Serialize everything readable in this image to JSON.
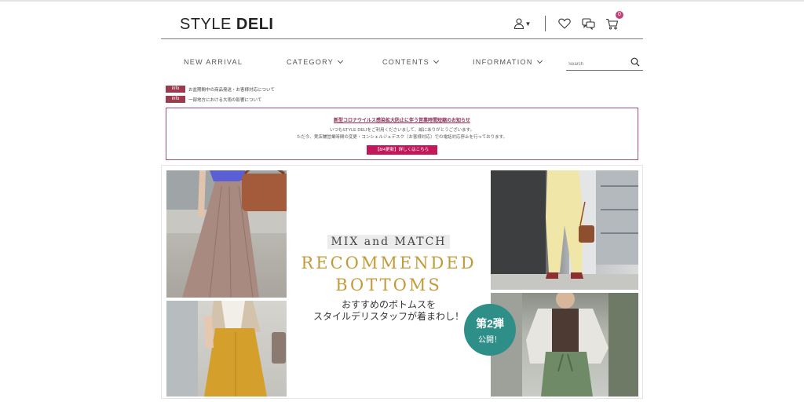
{
  "header": {
    "logo_light": "STYLE",
    "logo_bold": "DELI",
    "cart_count": "0"
  },
  "nav": {
    "items": [
      {
        "label": "NEW ARRIVAL"
      },
      {
        "label": "CATEGORY"
      },
      {
        "label": "CONTENTS"
      },
      {
        "label": "INFORMATION"
      }
    ],
    "search_placeholder": "Search"
  },
  "info": [
    {
      "tag": "info",
      "text": "お盆期間中の商品発送・お客様対応について"
    },
    {
      "tag": "info",
      "text": "一部地方における大雨の影響について"
    }
  ],
  "notice": {
    "title": "新型コロナウイルス感染拡大防止に伴う営業時間短縮のお知らせ",
    "line1": "いつもSTYLE DELIをご利用くださいまして、誠にありがとうございます。",
    "line2": "ただ今、実店舗営業時間の変更・コンシェルジュデスク（お客様対応）での電話対応停止を行っております。",
    "button": "【8/4更新】詳しくはこちら"
  },
  "banner": {
    "mix": "MIX and MATCH",
    "title1": "RECOMMENDED",
    "title2": "BOTTOMS",
    "jp1": "おすすめのボトムスを",
    "jp2": "スタイルデリスタッフが着まわし！",
    "circle1": "第2弾",
    "circle2": "公開！"
  },
  "colors": {
    "accent": "#c2185b",
    "notice_border": "#a24a82",
    "info_tag": "#9b3b4d",
    "gold": "#c39a3a",
    "teal": "#2e8f88"
  }
}
